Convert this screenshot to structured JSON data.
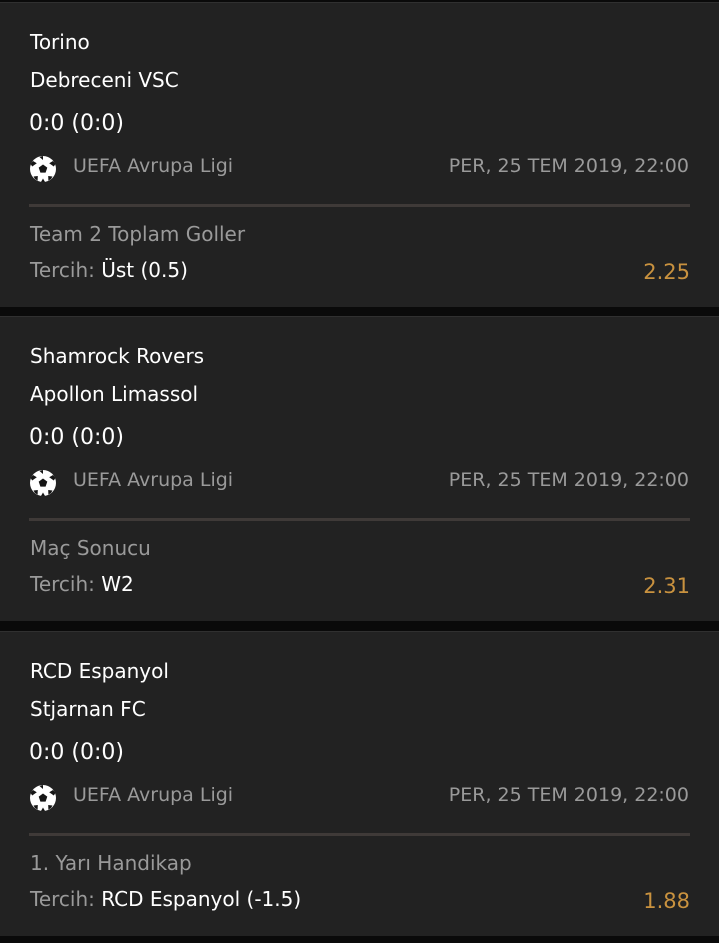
{
  "colors": {
    "background": "#0a0a0a",
    "card": "#222222",
    "text_primary": "#ffffff",
    "text_secondary": "#9a9a9a",
    "divider": "#3f3a38",
    "odds": "#c9923f"
  },
  "pick_label": "Tercih:",
  "bets": [
    {
      "team1": "Torino",
      "team2": "Debreceni VSC",
      "score": "0:0 (0:0)",
      "sport_icon": "soccer-ball-icon",
      "league": "UEFA Avrupa Ligi",
      "datetime": "PER, 25 TEM 2019, 22:00",
      "market": "Team 2 Toplam Goller",
      "pick": "Üst (0.5)",
      "odds": "2.25"
    },
    {
      "team1": "Shamrock Rovers",
      "team2": "Apollon Limassol",
      "score": "0:0 (0:0)",
      "sport_icon": "soccer-ball-icon",
      "league": "UEFA Avrupa Ligi",
      "datetime": "PER, 25 TEM 2019, 22:00",
      "market": "Maç Sonucu",
      "pick": "W2",
      "odds": "2.31"
    },
    {
      "team1": "RCD Espanyol",
      "team2": "Stjarnan FC",
      "score": "0:0 (0:0)",
      "sport_icon": "soccer-ball-icon",
      "league": "UEFA Avrupa Ligi",
      "datetime": "PER, 25 TEM 2019, 22:00",
      "market": "1. Yarı Handikap",
      "pick": "RCD Espanyol (-1.5)",
      "odds": "1.88"
    }
  ]
}
